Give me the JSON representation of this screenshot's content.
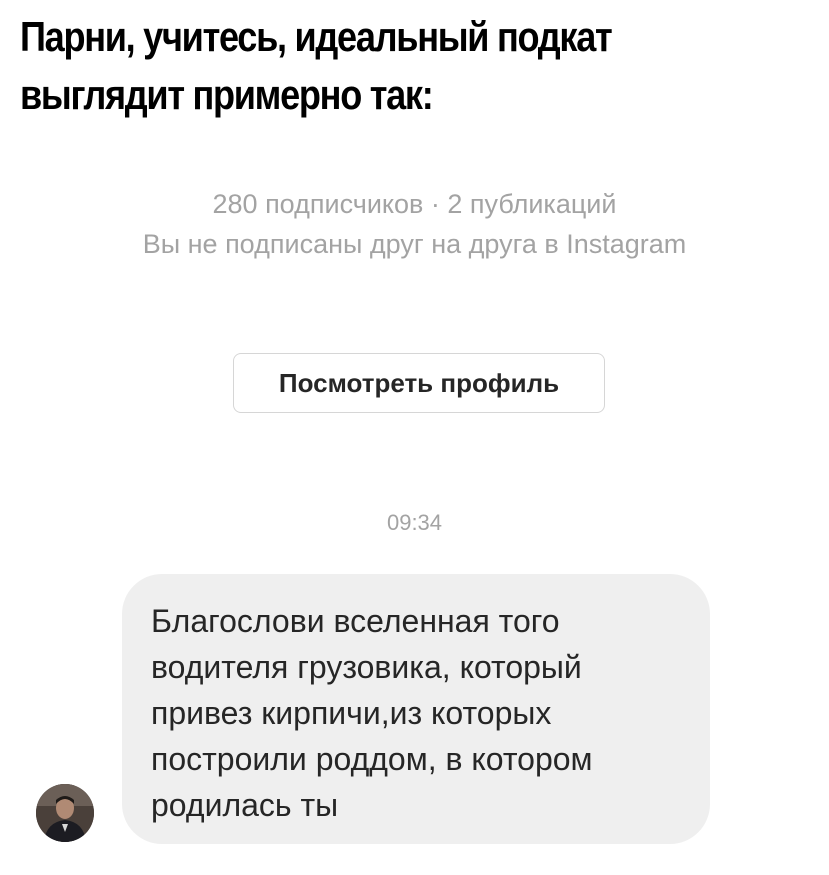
{
  "caption": {
    "line1": "Парни, учитесь, идеальный подкат",
    "line2": "выглядит примерно так:"
  },
  "profile": {
    "stats": "280 подписчиков · 2 публикаций",
    "follow_status": "Вы не подписаны друг на друга в Instagram",
    "view_profile_label": "Посмотреть профиль"
  },
  "conversation": {
    "timestamp": "09:34",
    "message": {
      "lines": [
        "Благослови вселенная того",
        "водителя грузовика, который",
        "привез кирпичи,из которых",
        "построили роддом, в котором",
        "родилась ты"
      ]
    }
  },
  "colors": {
    "muted_text": "#a3a3a3",
    "bubble_bg": "#efefef",
    "button_border": "#d6d6d6",
    "primary_text": "#262626"
  },
  "icons": {
    "avatar": "sender-avatar"
  }
}
